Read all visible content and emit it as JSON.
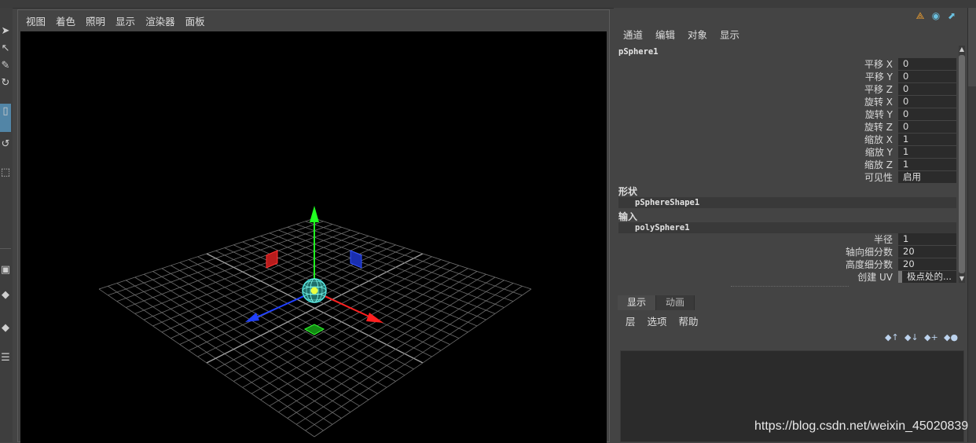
{
  "viewport": {
    "menu": [
      "视图",
      "着色",
      "照明",
      "显示",
      "渲染器",
      "面板"
    ]
  },
  "channel_box": {
    "menu": [
      "通道",
      "编辑",
      "对象",
      "显示"
    ],
    "node": "pSphere1",
    "attributes": [
      {
        "label": "平移 X",
        "value": "0"
      },
      {
        "label": "平移 Y",
        "value": "0"
      },
      {
        "label": "平移 Z",
        "value": "0"
      },
      {
        "label": "旋转 X",
        "value": "0"
      },
      {
        "label": "旋转 Y",
        "value": "0"
      },
      {
        "label": "旋转 Z",
        "value": "0"
      },
      {
        "label": "缩放 X",
        "value": "1"
      },
      {
        "label": "缩放 Y",
        "value": "1"
      },
      {
        "label": "缩放 Z",
        "value": "1"
      },
      {
        "label": "可见性",
        "value": "启用"
      }
    ],
    "shapes_header": "形状",
    "shape_node": "pSphereShape1",
    "inputs_header": "输入",
    "input_node": "polySphere1",
    "input_attributes": [
      {
        "label": "半径",
        "value": "1"
      },
      {
        "label": "轴向细分数",
        "value": "20"
      },
      {
        "label": "高度细分数",
        "value": "20"
      },
      {
        "label": "创建 UV",
        "value": "极点处的..."
      }
    ]
  },
  "layer_editor": {
    "tabs": [
      "显示",
      "动画"
    ],
    "menu": [
      "层",
      "选项",
      "帮助"
    ]
  },
  "watermark": "https://blog.csdn.net/weixin_45020839",
  "colors": {
    "background": "#444444",
    "viewport_bg": "#000000",
    "grid": "#808080",
    "axis_x": "#ff2020",
    "axis_y": "#20ff20",
    "axis_z": "#2040ff",
    "selection": "#43d9d9",
    "active_tool": "#5285a6"
  }
}
